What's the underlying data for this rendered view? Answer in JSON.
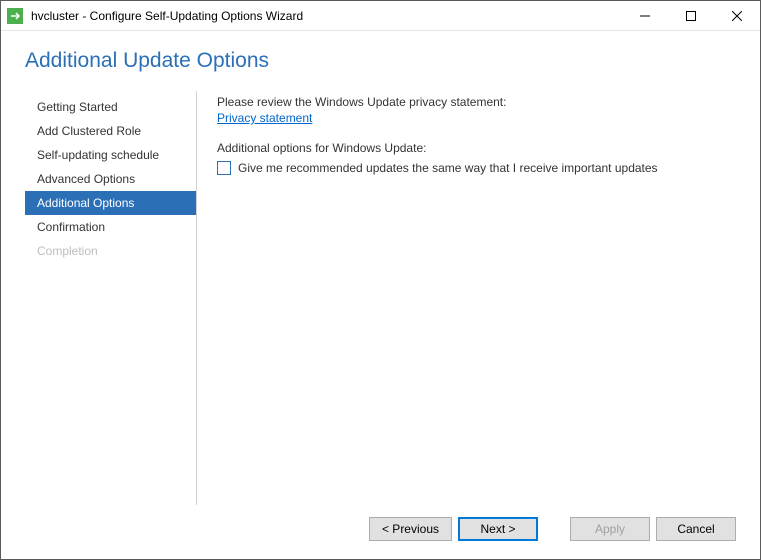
{
  "window": {
    "title": "hvcluster - Configure Self-Updating Options Wizard"
  },
  "heading": "Additional Update Options",
  "nav": {
    "items": [
      {
        "label": "Getting Started",
        "state": "normal"
      },
      {
        "label": "Add Clustered Role",
        "state": "normal"
      },
      {
        "label": "Self-updating schedule",
        "state": "normal"
      },
      {
        "label": "Advanced Options",
        "state": "normal"
      },
      {
        "label": "Additional Options",
        "state": "selected"
      },
      {
        "label": "Confirmation",
        "state": "normal"
      },
      {
        "label": "Completion",
        "state": "disabled"
      }
    ]
  },
  "main": {
    "review_text": "Please review the Windows Update privacy statement:",
    "link_text": "Privacy statement",
    "subheading": "Additional options for Windows Update:",
    "checkbox_label": "Give me recommended updates the same way that I receive important updates",
    "checkbox_checked": false
  },
  "buttons": {
    "previous": "< Previous",
    "next": "Next >",
    "apply": "Apply",
    "cancel": "Cancel"
  }
}
